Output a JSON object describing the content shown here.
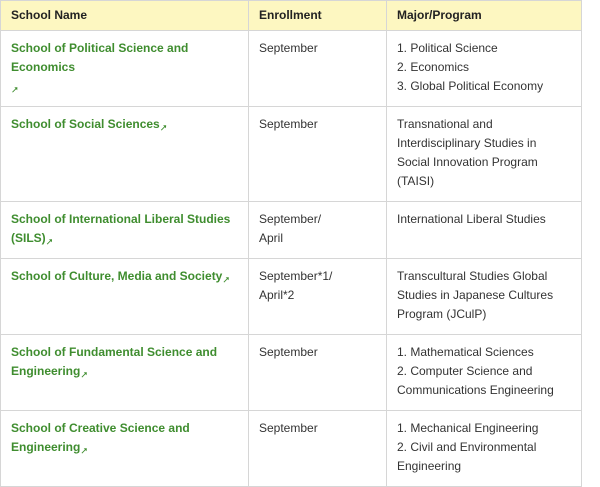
{
  "table": {
    "headers": {
      "school": "School Name",
      "enrollment": "Enrollment",
      "major": "Major/Program"
    },
    "rows": [
      {
        "school": "School of Political Science and Economics",
        "enrollment_lines": [
          "September"
        ],
        "majors": [
          "1. Political Science",
          "2. Economics",
          "3. Global Political Economy"
        ]
      },
      {
        "school": "School of Social Sciences",
        "enrollment_lines": [
          "September"
        ],
        "majors": [
          "Transnational and Interdisciplinary Studies in Social Innovation Program (TAISI)"
        ]
      },
      {
        "school": "School of International Liberal Studies (SILS)",
        "enrollment_lines": [
          "September/",
          "April"
        ],
        "majors": [
          "International Liberal Studies"
        ]
      },
      {
        "school": "School of Culture, Media and Society",
        "enrollment_lines": [
          "September*1/",
          "April*2"
        ],
        "majors": [
          "Transcultural Studies Global Studies in Japanese Cultures Program (JCulP)"
        ]
      },
      {
        "school": "School of Fundamental Science and Engineering",
        "enrollment_lines": [
          "September"
        ],
        "majors": [
          "1. Mathematical Sciences",
          "2. Computer Science and Communications Engineering"
        ]
      },
      {
        "school": "School of Creative Science and Engineering",
        "enrollment_lines": [
          "September"
        ],
        "majors": [
          "1. Mechanical Engineering",
          "2. Civil and Environmental Engineering"
        ]
      }
    ]
  },
  "icons": {
    "external_link": "external-link-icon"
  },
  "colors": {
    "header_bg": "#fdf7c1",
    "link": "#3f8d2f",
    "border": "#d6d6d6",
    "text": "#333333"
  }
}
